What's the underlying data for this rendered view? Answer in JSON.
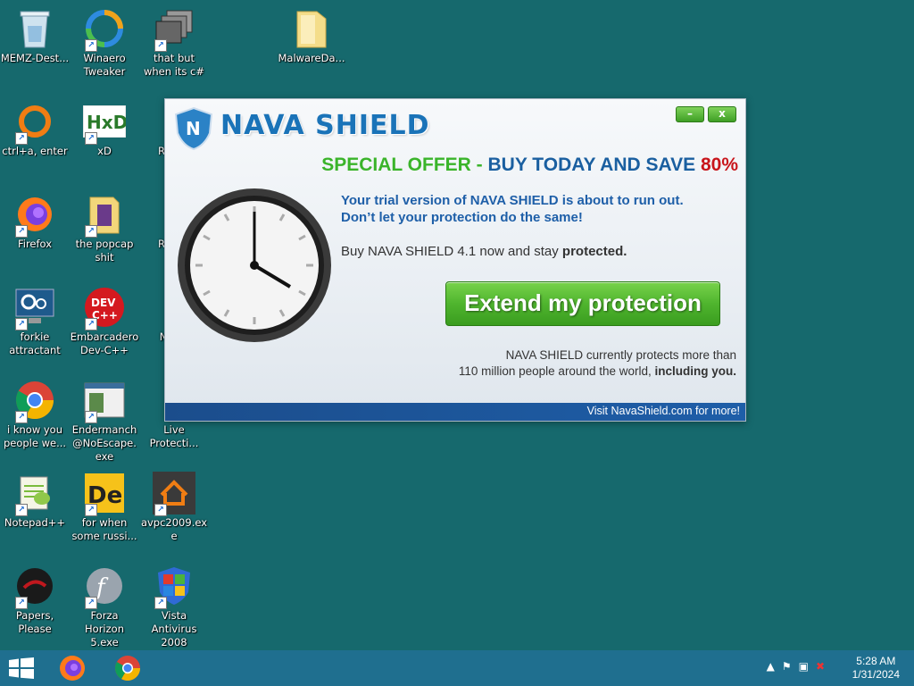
{
  "desktop_icons": [
    {
      "label": "MEMZ-Dest...",
      "icon": "recycle-bin-icon"
    },
    {
      "label": "Winaero Tweaker",
      "icon": "winaero-icon"
    },
    {
      "label": "that but when its c#",
      "icon": "stacked-windows-icon"
    },
    {
      "label": "MalwareDa...",
      "icon": "folder-icon"
    },
    {
      "label": "ctrl+a, enter",
      "icon": "orange-ring-icon"
    },
    {
      "label": "xD",
      "icon": "hxd-icon"
    },
    {
      "label": "Robl...",
      "icon": "roblox-icon"
    },
    {
      "label": "Firefox",
      "icon": "firefox-icon"
    },
    {
      "label": "the popcap shit",
      "icon": "folder-icon"
    },
    {
      "label": "Robl...",
      "icon": "roblox-icon"
    },
    {
      "label": "forkie attractant",
      "icon": "monitor-gear-icon"
    },
    {
      "label": "Embarcadero Dev-C++",
      "icon": "devcpp-icon"
    },
    {
      "label": "Nav...",
      "icon": "nava-icon"
    },
    {
      "label": "i know you people we...",
      "icon": "chrome-icon"
    },
    {
      "label": "Endermanch @NoEscape.exe",
      "icon": "window-app-icon"
    },
    {
      "label": "Live Protecti...",
      "icon": "shield-icon"
    },
    {
      "label": "Notepad++",
      "icon": "notepadpp-icon"
    },
    {
      "label": "for when some russi...",
      "icon": "de-icon"
    },
    {
      "label": "avpc2009.exe",
      "icon": "house-arrow-icon"
    },
    {
      "label": "Papers, Please",
      "icon": "papers-please-icon"
    },
    {
      "label": "Forza Horizon 5.exe",
      "icon": "flash-icon"
    },
    {
      "label": "Vista Antivirus 2008",
      "icon": "windows-shield-icon"
    }
  ],
  "popup": {
    "brand": "NAVA SHIELD",
    "minimize": "–",
    "close": "x",
    "offer_part1": "SPECIAL OFFER - ",
    "offer_part2": "BUY TODAY AND ",
    "offer_part3": "SAVE ",
    "offer_percent": "80%",
    "trial_line1": "Your trial version of NAVA SHIELD is about to run out.",
    "trial_line2": "Don’t let your protection do the same!",
    "buy_text": "Buy NAVA SHIELD 4.1 now and stay ",
    "buy_bold": "protected.",
    "button": "Extend my protection",
    "protects_line1": "NAVA SHIELD currently protects more than",
    "protects_line2": "110 million people around the world, ",
    "protects_bold": "including you.",
    "footer": "Visit NavaShield.com for more!"
  },
  "taskbar": {
    "time": "5:28 AM",
    "date": "1/31/2024",
    "apps": [
      "firefox-icon",
      "chrome-icon"
    ]
  },
  "colors": {
    "desktop": "#16696d",
    "brand_blue": "#1a73b8",
    "offer_green": "#3ab42a",
    "offer_red": "#c8151b",
    "button_green": "#4fb52e"
  }
}
